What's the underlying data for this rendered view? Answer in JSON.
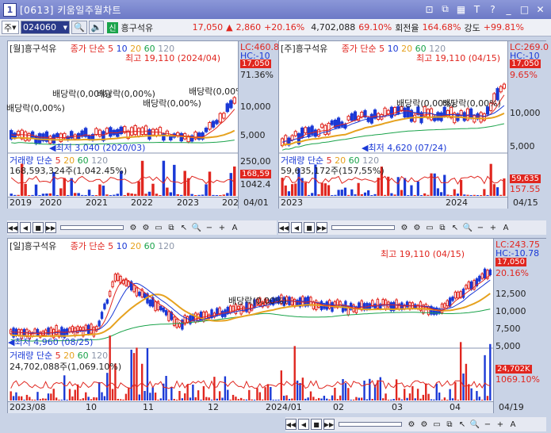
{
  "window": {
    "number": "1",
    "title": "[0613] 키움일주월차트",
    "controls": [
      "⊡",
      "⧉",
      "⧉",
      "T",
      "?",
      "_",
      "□",
      "✕"
    ]
  },
  "toolbar": {
    "market": "주",
    "code": "024060",
    "stock_badge": "신",
    "stock_name": "흥구석유",
    "price": "17,050",
    "change_arrow": "▲",
    "change": "2,860",
    "change_pct": "+20.16%",
    "volume": "4,702,088",
    "vol_ratio": "69.10%",
    "turnover_label": "회전율",
    "turnover": "164.68%",
    "strength_label": "강도",
    "strength": "+99.81%"
  },
  "colors": {
    "up": "#e0261f",
    "down": "#1a39d6",
    "ma5": "#e0261f",
    "ma10": "#1a39d6",
    "ma20": "#e6a21f",
    "ma60": "#1aa34a",
    "ma120": "#9aa5b8"
  },
  "monthly": {
    "header": {
      "period": "[월]",
      "name": "흥구석유",
      "ma_label": "종가 단순",
      "ma_periods": [
        "5",
        "10",
        "20",
        "60",
        "120"
      ]
    },
    "high": "최고 19,110 (2024/04)",
    "low": "최저 3,040 (2020/03)",
    "dividends": [
      "배당락(0,00%)",
      "배당락(0,00%)",
      "배당락(0,00%)",
      "배당락(0,00%)",
      "배당락(0,00%)",
      "배당락(0,00%)"
    ],
    "axis": {
      "lc": "LC:460.8",
      "hc": "HC:-10",
      "price_box": "17,050",
      "sub": "71.36%",
      "ticks": [
        "10,000",
        "5,000"
      ],
      "vol_ticks": [
        "250,00"
      ],
      "vol_box": "168,59",
      "vol_sub": "1042.4"
    },
    "volume": {
      "label": "거래량 단순",
      "periods": [
        "5",
        "20",
        "60",
        "120"
      ],
      "value": "168,593,324주(1,042.45%)"
    },
    "dates": [
      "2019",
      "2020",
      "2021",
      "2022",
      "2023",
      "2024"
    ],
    "end_date": "04/01"
  },
  "weekly": {
    "header": {
      "period": "[주]",
      "name": "흥구석유",
      "ma_label": "종가 단순",
      "ma_periods": [
        "5",
        "10",
        "20",
        "60",
        "120"
      ]
    },
    "high": "최고 19,110 (04/15)",
    "low": "최저 4,620 (07/24)",
    "dividends": [
      "배당락(0,00%)",
      "배당락(0,00%)"
    ],
    "axis": {
      "lc": "LC:269.0",
      "hc": "HC:-10",
      "price_box": "17,050",
      "sub": "9.65%",
      "ticks": [
        "10,000",
        "5,000"
      ],
      "vol_box": "59,635",
      "vol_sub": "157.55"
    },
    "volume": {
      "label": "거래량 단순",
      "periods": [
        "5",
        "20",
        "60",
        "120"
      ],
      "value": "59,635,172주(157,55%)"
    },
    "dates": [
      "2023",
      "2024"
    ],
    "end_date": "04/15"
  },
  "daily": {
    "header": {
      "period": "[일]",
      "name": "흥구석유",
      "ma_label": "종가 단순",
      "ma_periods": [
        "5",
        "10",
        "20",
        "60",
        "120"
      ]
    },
    "high": "최고 19,110 (04/15)",
    "low": "최저 4,960 (08/25)",
    "dividend": "배당락(0,00%)",
    "axis": {
      "lc": "LC:243.75",
      "hc": "HC:-10.78",
      "price_box": "17,050",
      "sub": "20.16%",
      "ticks": [
        "12,500",
        "10,000",
        "7,500",
        "5,000"
      ],
      "vol_box": "24,702K",
      "vol_sub": "1069.10%"
    },
    "volume": {
      "label": "거래량 단순",
      "periods": [
        "5",
        "20",
        "60",
        "120"
      ],
      "value": "24,702,088주(1,069.10%)"
    },
    "dates": [
      "2023/08",
      "10",
      "11",
      "12",
      "2024/01",
      "02",
      "03",
      "04"
    ],
    "end_date": "04/19"
  }
}
